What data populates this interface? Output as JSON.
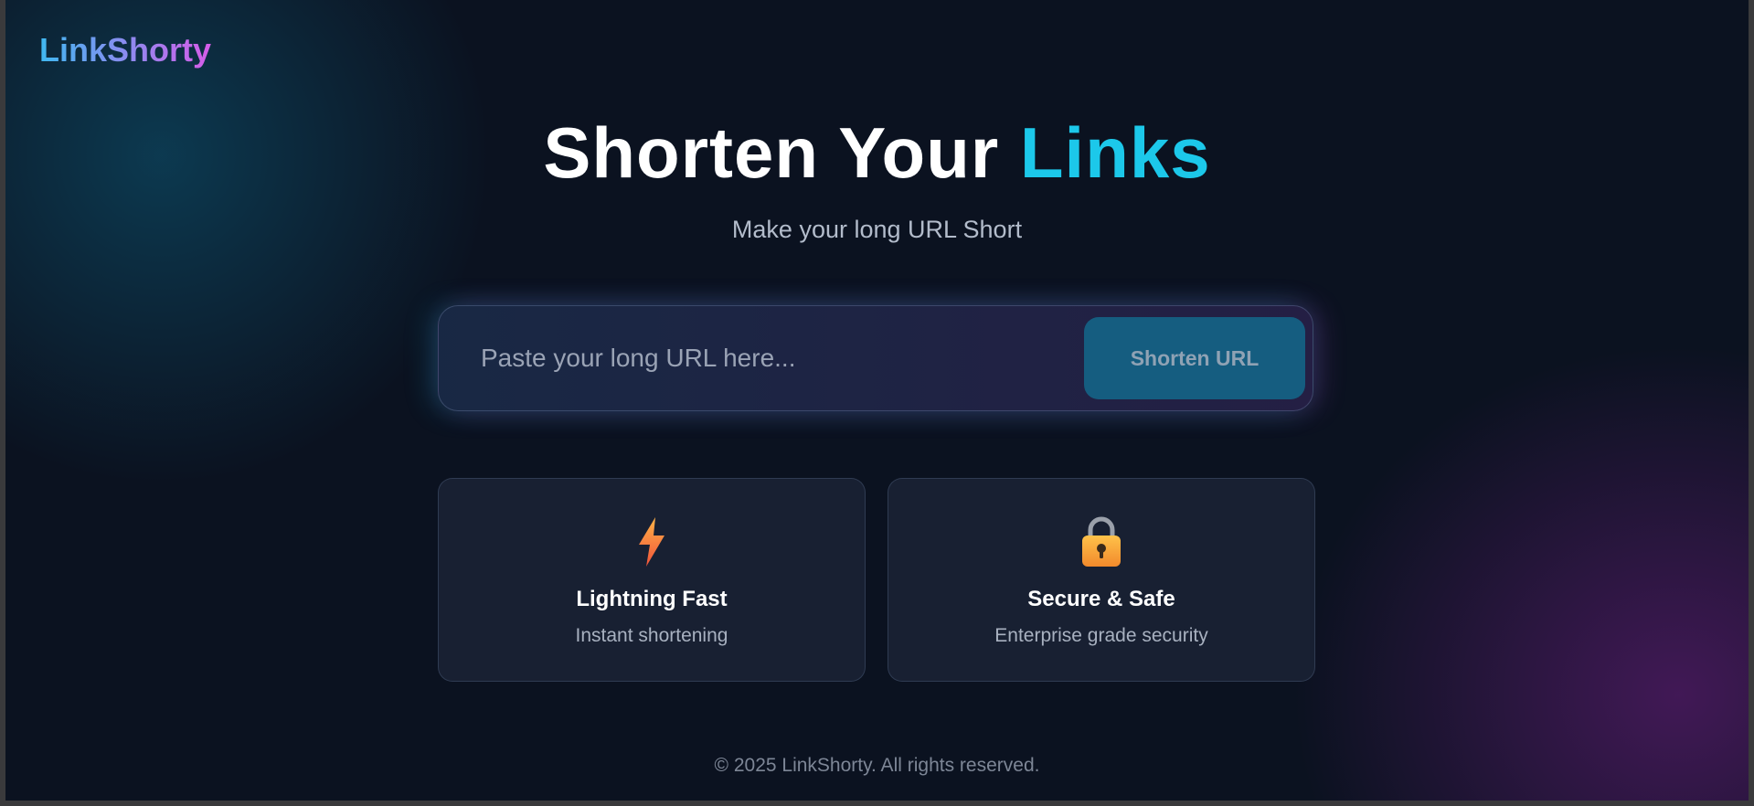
{
  "brand": {
    "logo_text": "LinkShorty"
  },
  "hero": {
    "title_main": "Shorten Your",
    "title_accent": "Links",
    "subtitle": "Make your long URL Short"
  },
  "shortener": {
    "input_placeholder": "Paste your long URL here...",
    "input_value": "",
    "button_label": "Shorten URL"
  },
  "features": [
    {
      "icon": "lightning-icon",
      "title": "Lightning Fast",
      "description": "Instant shortening"
    },
    {
      "icon": "lock-icon",
      "title": "Secure & Safe",
      "description": "Enterprise grade security"
    }
  ],
  "footer": {
    "copyright": "© 2025 LinkShorty. All rights reserved."
  },
  "colors": {
    "background": "#0b1220",
    "accent_cyan": "#1cc8ea",
    "logo_gradient_start": "#3fb8f0",
    "logo_gradient_end": "#d65ce8",
    "button_bg": "#155d80"
  }
}
